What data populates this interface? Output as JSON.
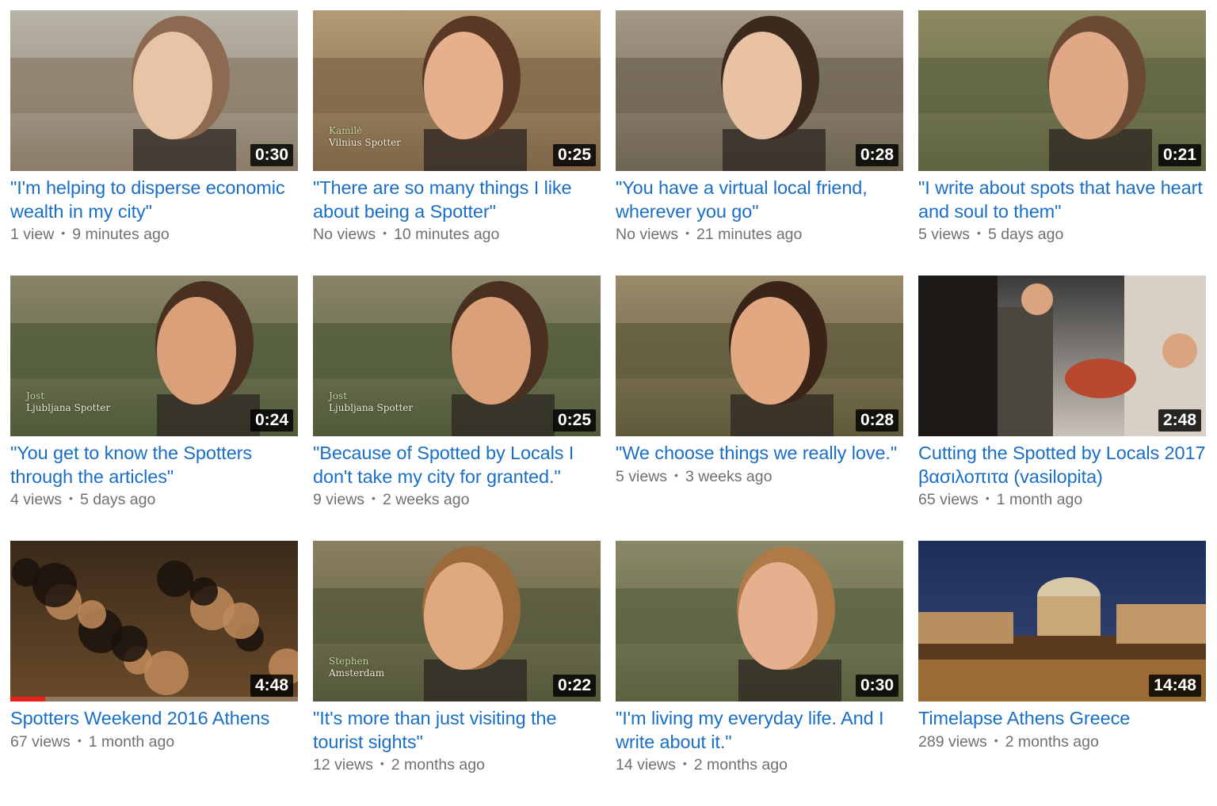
{
  "colors": {
    "title_link": "#1a6fc4",
    "meta_text": "#707070",
    "duration_bg": "#000000",
    "progress": "#e62117"
  },
  "videos": [
    {
      "title": "\"I'm helping to disperse economic wealth in my city\"",
      "views": "1 view",
      "age": "9 minutes ago",
      "duration": "0:30",
      "caption_name": "",
      "caption_city": "",
      "progress": 0,
      "palette": [
        "#b9b4a8",
        "#8a7c68",
        "#e8c4a6",
        "#8c6a52"
      ]
    },
    {
      "title": "\"There are so many things I like about being a Spotter\"",
      "views": "No views",
      "age": "10 minutes ago",
      "duration": "0:25",
      "caption_name": "Kamilė",
      "caption_city": "Vilnius Spotter",
      "progress": 0,
      "palette": [
        "#b49a74",
        "#7d6548",
        "#e6b08c",
        "#5a3826"
      ]
    },
    {
      "title": "\"You have a virtual local friend, wherever you go\"",
      "views": "No views",
      "age": "21 minutes ago",
      "duration": "0:28",
      "caption_name": "",
      "caption_city": "",
      "progress": 0,
      "palette": [
        "#a49886",
        "#6e6452",
        "#e9c2a4",
        "#3d2a1e"
      ]
    },
    {
      "title": "\"I write about spots that have heart and soul to them\"",
      "views": "5 views",
      "age": "5 days ago",
      "duration": "0:21",
      "caption_name": "",
      "caption_city": "",
      "progress": 0,
      "palette": [
        "#8c8a62",
        "#5d6240",
        "#e0a884",
        "#6a4a32"
      ]
    },
    {
      "title": "\"You get to know the Spotters through the articles\"",
      "views": "4 views",
      "age": "5 days ago",
      "duration": "0:24",
      "caption_name": "Jost",
      "caption_city": "Ljubljana Spotter",
      "progress": 0,
      "palette": [
        "#8a8468",
        "#4e5a38",
        "#d9a07a",
        "#4a3020"
      ]
    },
    {
      "title": "\"Because of Spotted by Locals I don't take my city for granted.\"",
      "views": "9 views",
      "age": "2 weeks ago",
      "duration": "0:25",
      "caption_name": "Jost",
      "caption_city": "Ljubljana Spotter",
      "progress": 0,
      "palette": [
        "#8a8468",
        "#4e5a38",
        "#d9a07a",
        "#4a3020"
      ]
    },
    {
      "title": "\"We choose things we really love.\"",
      "views": "5 views",
      "age": "3 weeks ago",
      "duration": "0:28",
      "caption_name": "",
      "caption_city": "",
      "progress": 0,
      "palette": [
        "#9a8a6a",
        "#5e5a3a",
        "#e2a882",
        "#3a2418"
      ]
    },
    {
      "title": "Cutting the Spotted by Locals 2017 βασιλοπιτα (vasilopita)",
      "views": "65 views",
      "age": "1 month ago",
      "duration": "2:48",
      "caption_name": "",
      "caption_city": "",
      "progress": 0,
      "palette": [
        "#3a3a3a",
        "#c9c2b8",
        "#d9a47e",
        "#2a2420"
      ]
    },
    {
      "title": "Spotters Weekend 2016 Athens",
      "views": "67 views",
      "age": "1 month ago",
      "duration": "4:48",
      "caption_name": "",
      "caption_city": "",
      "progress": 0.12,
      "palette": [
        "#3a2a1a",
        "#6a4a2a",
        "#c08a5a",
        "#1a120c"
      ]
    },
    {
      "title": "\"It's more than just visiting the tourist sights\"",
      "views": "12 views",
      "age": "2 months ago",
      "duration": "0:22",
      "caption_name": "Stephen",
      "caption_city": "Amsterdam",
      "progress": 0,
      "palette": [
        "#8a8060",
        "#54583a",
        "#e0a87e",
        "#9a6a3a"
      ]
    },
    {
      "title": "\"I'm living my everyday life. And I write about it.\"",
      "views": "14 views",
      "age": "2 months ago",
      "duration": "0:30",
      "caption_name": "",
      "caption_city": "",
      "progress": 0,
      "palette": [
        "#8a8868",
        "#5a6240",
        "#e6b08e",
        "#b07a48"
      ]
    },
    {
      "title": "Timelapse Athens Greece",
      "views": "289 views",
      "age": "2 months ago",
      "duration": "14:48",
      "caption_name": "",
      "caption_city": "",
      "progress": 0,
      "palette": [
        "#1c2e5a",
        "#3a4a78",
        "#e0a860",
        "#f2d6a0"
      ]
    }
  ]
}
